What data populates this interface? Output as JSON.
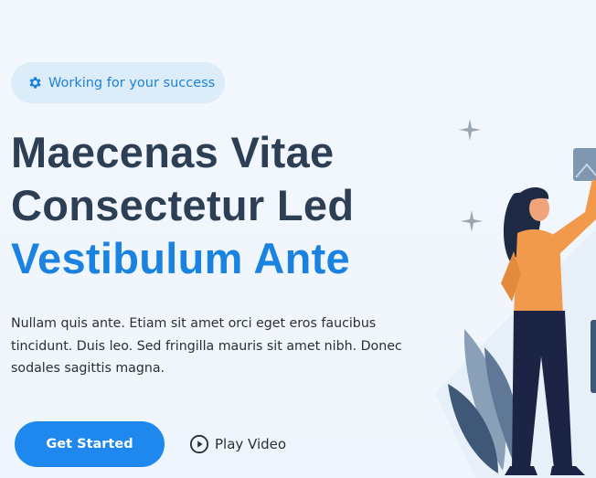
{
  "hero": {
    "badge": {
      "icon": "gear-icon",
      "text": "Working for your success"
    },
    "title": {
      "line1": "Maecenas Vitae",
      "line2": "Consectetur Led",
      "line3": "Vestibulum Ante"
    },
    "description": "Nullam quis ante. Etiam sit amet orci eget eros faucibus tincidunt. Duis leo. Sed fringilla mauris sit amet nibh. Donec sodales sagittis magna.",
    "cta": {
      "primary_label": "Get Started",
      "video_label": "Play Video",
      "video_icon": "play-circle-icon"
    },
    "illustration": "woman-with-picture-illustration"
  },
  "colors": {
    "accent": "#1a82e0",
    "heading": "#2c3f55",
    "button": "#1e88ef",
    "badge_bg": "#dcecf9",
    "page_bg": "#f3f8fd"
  }
}
